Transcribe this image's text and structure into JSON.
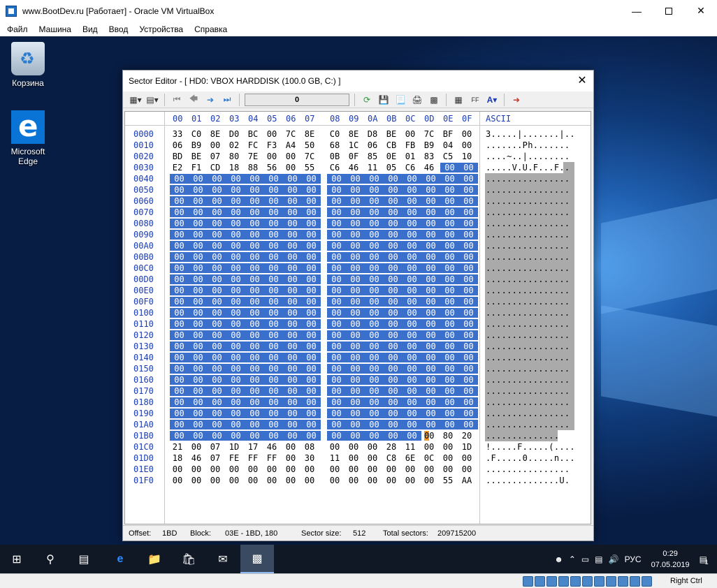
{
  "host": {
    "title": "www.BootDev.ru [Работает] - Oracle VM VirtualBox",
    "menu": [
      "Файл",
      "Машина",
      "Вид",
      "Ввод",
      "Устройства",
      "Справка"
    ],
    "host_key": "Right Ctrl"
  },
  "desktop": {
    "icons": [
      {
        "label": "Корзина",
        "icon": "recycle-bin-icon"
      },
      {
        "label": "Microsoft Edge",
        "icon": "edge-icon"
      }
    ]
  },
  "sector_editor": {
    "title": "Sector Editor - [ HD0: VBOX HARDDISK (100.0 GB, C:) ]",
    "sector_value": "0",
    "column_headers": [
      "00",
      "01",
      "02",
      "03",
      "04",
      "05",
      "06",
      "07",
      "08",
      "09",
      "0A",
      "0B",
      "0C",
      "0D",
      "0E",
      "0F"
    ],
    "ascii_header": "ASCII",
    "rows": [
      {
        "addr": "0000",
        "bytes": [
          "33",
          "C0",
          "8E",
          "D0",
          "BC",
          "00",
          "7C",
          "8E",
          "C0",
          "8E",
          "D8",
          "BE",
          "00",
          "7C",
          "BF",
          "00"
        ],
        "ascii": "3.....|.......|.."
      },
      {
        "addr": "0010",
        "bytes": [
          "06",
          "B9",
          "00",
          "02",
          "FC",
          "F3",
          "A4",
          "50",
          "68",
          "1C",
          "06",
          "CB",
          "FB",
          "B9",
          "04",
          "00"
        ],
        "ascii": ".......Ph......."
      },
      {
        "addr": "0020",
        "bytes": [
          "BD",
          "BE",
          "07",
          "80",
          "7E",
          "00",
          "00",
          "7C",
          "0B",
          "0F",
          "85",
          "0E",
          "01",
          "83",
          "C5",
          "10"
        ],
        "ascii": "....~..|........"
      },
      {
        "addr": "0030",
        "bytes": [
          "E2",
          "F1",
          "CD",
          "18",
          "88",
          "56",
          "00",
          "55",
          "C6",
          "46",
          "11",
          "05",
          "C6",
          "46",
          "00",
          "00"
        ],
        "ascii": ".....V.U.F...F.."
      },
      {
        "addr": "0040",
        "bytes": [
          "00",
          "00",
          "00",
          "00",
          "00",
          "00",
          "00",
          "00",
          "00",
          "00",
          "00",
          "00",
          "00",
          "00",
          "00",
          "00"
        ],
        "ascii": "................"
      },
      {
        "addr": "0050",
        "bytes": [
          "00",
          "00",
          "00",
          "00",
          "00",
          "00",
          "00",
          "00",
          "00",
          "00",
          "00",
          "00",
          "00",
          "00",
          "00",
          "00"
        ],
        "ascii": "................"
      },
      {
        "addr": "0060",
        "bytes": [
          "00",
          "00",
          "00",
          "00",
          "00",
          "00",
          "00",
          "00",
          "00",
          "00",
          "00",
          "00",
          "00",
          "00",
          "00",
          "00"
        ],
        "ascii": "................"
      },
      {
        "addr": "0070",
        "bytes": [
          "00",
          "00",
          "00",
          "00",
          "00",
          "00",
          "00",
          "00",
          "00",
          "00",
          "00",
          "00",
          "00",
          "00",
          "00",
          "00"
        ],
        "ascii": "................"
      },
      {
        "addr": "0080",
        "bytes": [
          "00",
          "00",
          "00",
          "00",
          "00",
          "00",
          "00",
          "00",
          "00",
          "00",
          "00",
          "00",
          "00",
          "00",
          "00",
          "00"
        ],
        "ascii": "................"
      },
      {
        "addr": "0090",
        "bytes": [
          "00",
          "00",
          "00",
          "00",
          "00",
          "00",
          "00",
          "00",
          "00",
          "00",
          "00",
          "00",
          "00",
          "00",
          "00",
          "00"
        ],
        "ascii": "................"
      },
      {
        "addr": "00A0",
        "bytes": [
          "00",
          "00",
          "00",
          "00",
          "00",
          "00",
          "00",
          "00",
          "00",
          "00",
          "00",
          "00",
          "00",
          "00",
          "00",
          "00"
        ],
        "ascii": "................"
      },
      {
        "addr": "00B0",
        "bytes": [
          "00",
          "00",
          "00",
          "00",
          "00",
          "00",
          "00",
          "00",
          "00",
          "00",
          "00",
          "00",
          "00",
          "00",
          "00",
          "00"
        ],
        "ascii": "................"
      },
      {
        "addr": "00C0",
        "bytes": [
          "00",
          "00",
          "00",
          "00",
          "00",
          "00",
          "00",
          "00",
          "00",
          "00",
          "00",
          "00",
          "00",
          "00",
          "00",
          "00"
        ],
        "ascii": "................"
      },
      {
        "addr": "00D0",
        "bytes": [
          "00",
          "00",
          "00",
          "00",
          "00",
          "00",
          "00",
          "00",
          "00",
          "00",
          "00",
          "00",
          "00",
          "00",
          "00",
          "00"
        ],
        "ascii": "................"
      },
      {
        "addr": "00E0",
        "bytes": [
          "00",
          "00",
          "00",
          "00",
          "00",
          "00",
          "00",
          "00",
          "00",
          "00",
          "00",
          "00",
          "00",
          "00",
          "00",
          "00"
        ],
        "ascii": "................"
      },
      {
        "addr": "00F0",
        "bytes": [
          "00",
          "00",
          "00",
          "00",
          "00",
          "00",
          "00",
          "00",
          "00",
          "00",
          "00",
          "00",
          "00",
          "00",
          "00",
          "00"
        ],
        "ascii": "................"
      },
      {
        "addr": "0100",
        "bytes": [
          "00",
          "00",
          "00",
          "00",
          "00",
          "00",
          "00",
          "00",
          "00",
          "00",
          "00",
          "00",
          "00",
          "00",
          "00",
          "00"
        ],
        "ascii": "................"
      },
      {
        "addr": "0110",
        "bytes": [
          "00",
          "00",
          "00",
          "00",
          "00",
          "00",
          "00",
          "00",
          "00",
          "00",
          "00",
          "00",
          "00",
          "00",
          "00",
          "00"
        ],
        "ascii": "................"
      },
      {
        "addr": "0120",
        "bytes": [
          "00",
          "00",
          "00",
          "00",
          "00",
          "00",
          "00",
          "00",
          "00",
          "00",
          "00",
          "00",
          "00",
          "00",
          "00",
          "00"
        ],
        "ascii": "................"
      },
      {
        "addr": "0130",
        "bytes": [
          "00",
          "00",
          "00",
          "00",
          "00",
          "00",
          "00",
          "00",
          "00",
          "00",
          "00",
          "00",
          "00",
          "00",
          "00",
          "00"
        ],
        "ascii": "................"
      },
      {
        "addr": "0140",
        "bytes": [
          "00",
          "00",
          "00",
          "00",
          "00",
          "00",
          "00",
          "00",
          "00",
          "00",
          "00",
          "00",
          "00",
          "00",
          "00",
          "00"
        ],
        "ascii": "................"
      },
      {
        "addr": "0150",
        "bytes": [
          "00",
          "00",
          "00",
          "00",
          "00",
          "00",
          "00",
          "00",
          "00",
          "00",
          "00",
          "00",
          "00",
          "00",
          "00",
          "00"
        ],
        "ascii": "................"
      },
      {
        "addr": "0160",
        "bytes": [
          "00",
          "00",
          "00",
          "00",
          "00",
          "00",
          "00",
          "00",
          "00",
          "00",
          "00",
          "00",
          "00",
          "00",
          "00",
          "00"
        ],
        "ascii": "................"
      },
      {
        "addr": "0170",
        "bytes": [
          "00",
          "00",
          "00",
          "00",
          "00",
          "00",
          "00",
          "00",
          "00",
          "00",
          "00",
          "00",
          "00",
          "00",
          "00",
          "00"
        ],
        "ascii": "................"
      },
      {
        "addr": "0180",
        "bytes": [
          "00",
          "00",
          "00",
          "00",
          "00",
          "00",
          "00",
          "00",
          "00",
          "00",
          "00",
          "00",
          "00",
          "00",
          "00",
          "00"
        ],
        "ascii": "................"
      },
      {
        "addr": "0190",
        "bytes": [
          "00",
          "00",
          "00",
          "00",
          "00",
          "00",
          "00",
          "00",
          "00",
          "00",
          "00",
          "00",
          "00",
          "00",
          "00",
          "00"
        ],
        "ascii": "................"
      },
      {
        "addr": "01A0",
        "bytes": [
          "00",
          "00",
          "00",
          "00",
          "00",
          "00",
          "00",
          "00",
          "00",
          "00",
          "00",
          "00",
          "00",
          "00",
          "00",
          "00"
        ],
        "ascii": "................"
      },
      {
        "addr": "01B0",
        "bytes": [
          "00",
          "00",
          "00",
          "00",
          "00",
          "00",
          "00",
          "00",
          "00",
          "00",
          "00",
          "00",
          "00",
          "00",
          "80",
          "20"
        ],
        "ascii": ".............. "
      },
      {
        "addr": "01C0",
        "bytes": [
          "21",
          "00",
          "07",
          "1D",
          "17",
          "46",
          "00",
          "08",
          "00",
          "00",
          "00",
          "28",
          "11",
          "00",
          "00",
          "1D"
        ],
        "ascii": "!.....F.....(...."
      },
      {
        "addr": "01D0",
        "bytes": [
          "18",
          "46",
          "07",
          "FE",
          "FF",
          "FF",
          "00",
          "30",
          "11",
          "00",
          "00",
          "C8",
          "6E",
          "0C",
          "00",
          "00"
        ],
        "ascii": ".F.....0.....n..."
      },
      {
        "addr": "01E0",
        "bytes": [
          "00",
          "00",
          "00",
          "00",
          "00",
          "00",
          "00",
          "00",
          "00",
          "00",
          "00",
          "00",
          "00",
          "00",
          "00",
          "00"
        ],
        "ascii": "................"
      },
      {
        "addr": "01F0",
        "bytes": [
          "00",
          "00",
          "00",
          "00",
          "00",
          "00",
          "00",
          "00",
          "00",
          "00",
          "00",
          "00",
          "00",
          "00",
          "55",
          "AA"
        ],
        "ascii": "..............U."
      }
    ],
    "status": {
      "offset_label": "Offset:",
      "offset_value": "1BD",
      "block_label": "Block:",
      "block_value": "03E - 1BD, 180",
      "sector_size_label": "Sector size:",
      "sector_size_value": "512",
      "total_sectors_label": "Total sectors:",
      "total_sectors_value": "209715200"
    }
  },
  "taskbar": {
    "language": "РУС",
    "time": "0:29",
    "date": "07.05.2019",
    "notification_count": "1"
  }
}
